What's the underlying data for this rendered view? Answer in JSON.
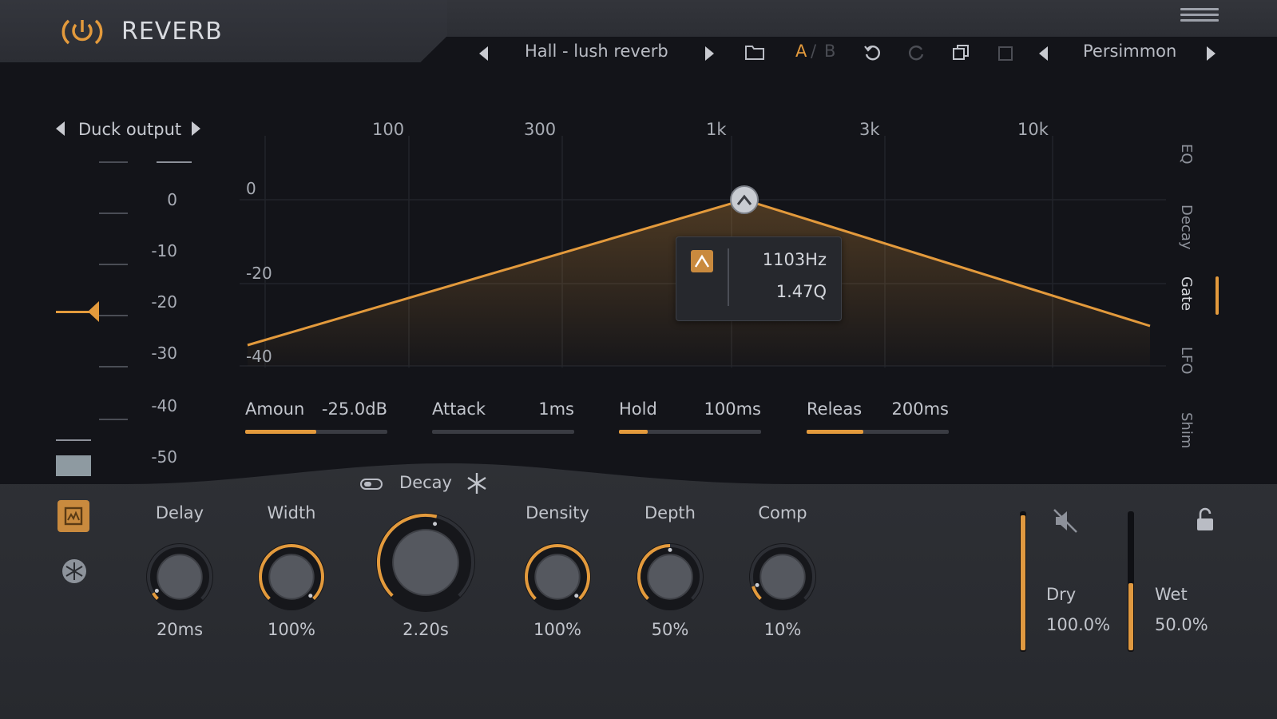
{
  "header": {
    "title": "REVERB",
    "preset_name": "Hall - lush reverb",
    "ab_a": "A",
    "ab_sep": "/",
    "ab_b": "B",
    "theme_name": "Persimmon"
  },
  "ducking": {
    "mode_label": "Duck output",
    "scale": [
      "0",
      "-10",
      "-20",
      "-30",
      "-40",
      "-50"
    ],
    "threshold_db": -22
  },
  "graph": {
    "freq_labels": [
      "100",
      "300",
      "1k",
      "3k",
      "10k"
    ],
    "db_labels": [
      "0",
      "-20",
      "-40"
    ],
    "tooltip": {
      "freq": "1103Hz",
      "q": "1.47Q"
    }
  },
  "side_tabs": [
    "EQ",
    "Decay",
    "Gate",
    "LFO",
    "Shim"
  ],
  "params": [
    {
      "name": "Amoun",
      "value": "-25.0dB",
      "fill": 0.5
    },
    {
      "name": "Attack",
      "value": "1ms",
      "fill": 0.0
    },
    {
      "name": "Hold",
      "value": "100ms",
      "fill": 0.2
    },
    {
      "name": "Releas",
      "value": "200ms",
      "fill": 0.4
    }
  ],
  "knobs": [
    {
      "name": "Delay",
      "value": "20ms",
      "level": 0.05
    },
    {
      "name": "Width",
      "value": "100%",
      "level": 1.0
    },
    {
      "name": "Decay",
      "value": "2.20s",
      "level": 0.55
    },
    {
      "name": "Density",
      "value": "100%",
      "level": 1.0
    },
    {
      "name": "Depth",
      "value": "50%",
      "level": 0.5
    },
    {
      "name": "Comp",
      "value": "10%",
      "level": 0.1
    }
  ],
  "mix": {
    "dry_label": "Dry",
    "dry_value": "100.0%",
    "dry_level": 1.0,
    "wet_label": "Wet",
    "wet_value": "50.0%",
    "wet_level": 0.5
  },
  "colors": {
    "accent": "#e39a3c",
    "background": "#131419",
    "panel": "#2a2c31"
  },
  "icons": [
    "power-icon",
    "menu-icon",
    "folder-icon",
    "undo-icon",
    "redo-icon",
    "copy-icon",
    "paste-icon",
    "freeze-icon",
    "snowflake-icon",
    "speaker-mute-icon",
    "lock-icon",
    "spectrum-icon"
  ]
}
